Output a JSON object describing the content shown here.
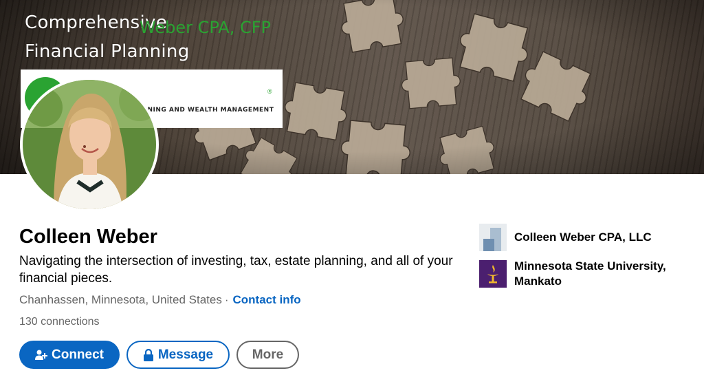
{
  "banner": {
    "title_line1": "Comprehensive",
    "title_line2": "Financial Planning",
    "logo_text": "Weber CPA, CFP",
    "logo_reg": "®",
    "logo_subtitle": "ANNING AND WEALTH MANAGEMENT"
  },
  "profile": {
    "name": "Colleen Weber",
    "headline": "Navigating the intersection of investing, tax, estate planning, and all of your financial pieces.",
    "location": "Chanhassen, Minnesota, United States",
    "separator": "·",
    "contact_info": "Contact info",
    "connections_count": "130",
    "connections_label": "connections"
  },
  "actions": {
    "connect": "Connect",
    "message": "Message",
    "more": "More"
  },
  "sidebar": {
    "company": "Colleen Weber CPA, LLC",
    "school": "Minnesota State University, Mankato"
  },
  "icons": {
    "connect": "add-person-icon",
    "message": "lock-icon",
    "company": "company-logo",
    "school": "university-logo"
  },
  "colors": {
    "primary": "#0a66c2",
    "muted": "#666666",
    "brand_green": "#2aa332",
    "school_purple": "#4b1f6f"
  }
}
